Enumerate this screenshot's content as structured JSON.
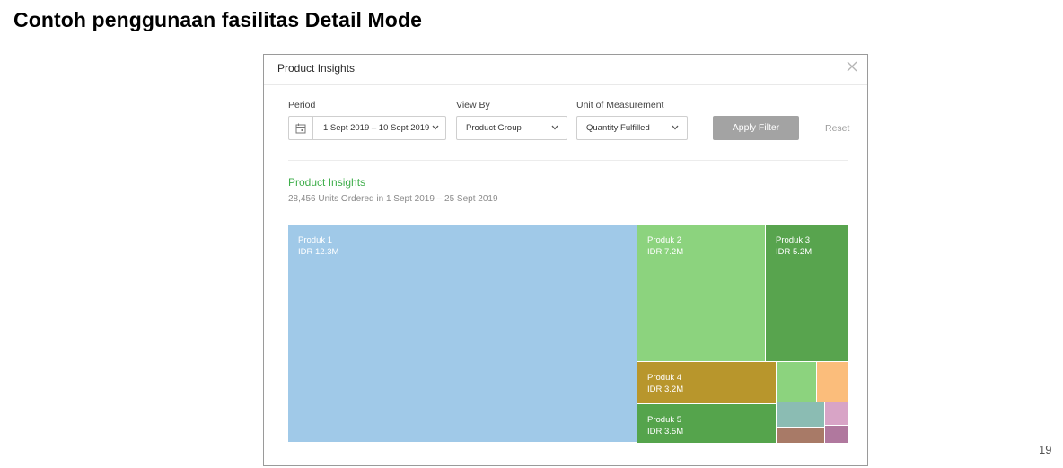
{
  "slide": {
    "title": "Contoh penggunaan fasilitas Detail Mode",
    "page_number": "19"
  },
  "modal": {
    "title": "Product Insights",
    "filters": {
      "period_label": "Period",
      "period_value": "1 Sept 2019 – 10 Sept 2019",
      "view_by_label": "View By",
      "view_by_value": "Product Group",
      "unit_label": "Unit of Measurement",
      "unit_value": "Quantity Fulfilled",
      "apply_label": "Apply Filter",
      "reset_label": "Reset"
    },
    "insights": {
      "title": "Product Insights",
      "subtitle": "28,456 Units Ordered in 1 Sept 2019 – 25 Sept 2019"
    },
    "treemap": {
      "tiles": [
        {
          "name": "Produk 1",
          "value": "IDR 12.3M",
          "color": "#a0c9e8"
        },
        {
          "name": "Produk 2",
          "value": "IDR 7.2M",
          "color": "#8cd37e"
        },
        {
          "name": "Produk 3",
          "value": "IDR 5.2M",
          "color": "#58a44e"
        },
        {
          "name": "Produk 4",
          "value": "IDR 3.2M",
          "color": "#b8962c"
        },
        {
          "name": "Produk 5",
          "value": "IDR 3.5M",
          "color": "#55a44c"
        },
        {
          "name": "",
          "value": "",
          "color": "#8cd37e"
        },
        {
          "name": "",
          "value": "",
          "color": "#fbbd7b"
        },
        {
          "name": "",
          "value": "",
          "color": "#8bbcb3"
        },
        {
          "name": "",
          "value": "",
          "color": "#d8a4c6"
        },
        {
          "name": "",
          "value": "",
          "color": "#a87a67"
        },
        {
          "name": "",
          "value": "",
          "color": "#b0789e"
        }
      ]
    }
  }
}
